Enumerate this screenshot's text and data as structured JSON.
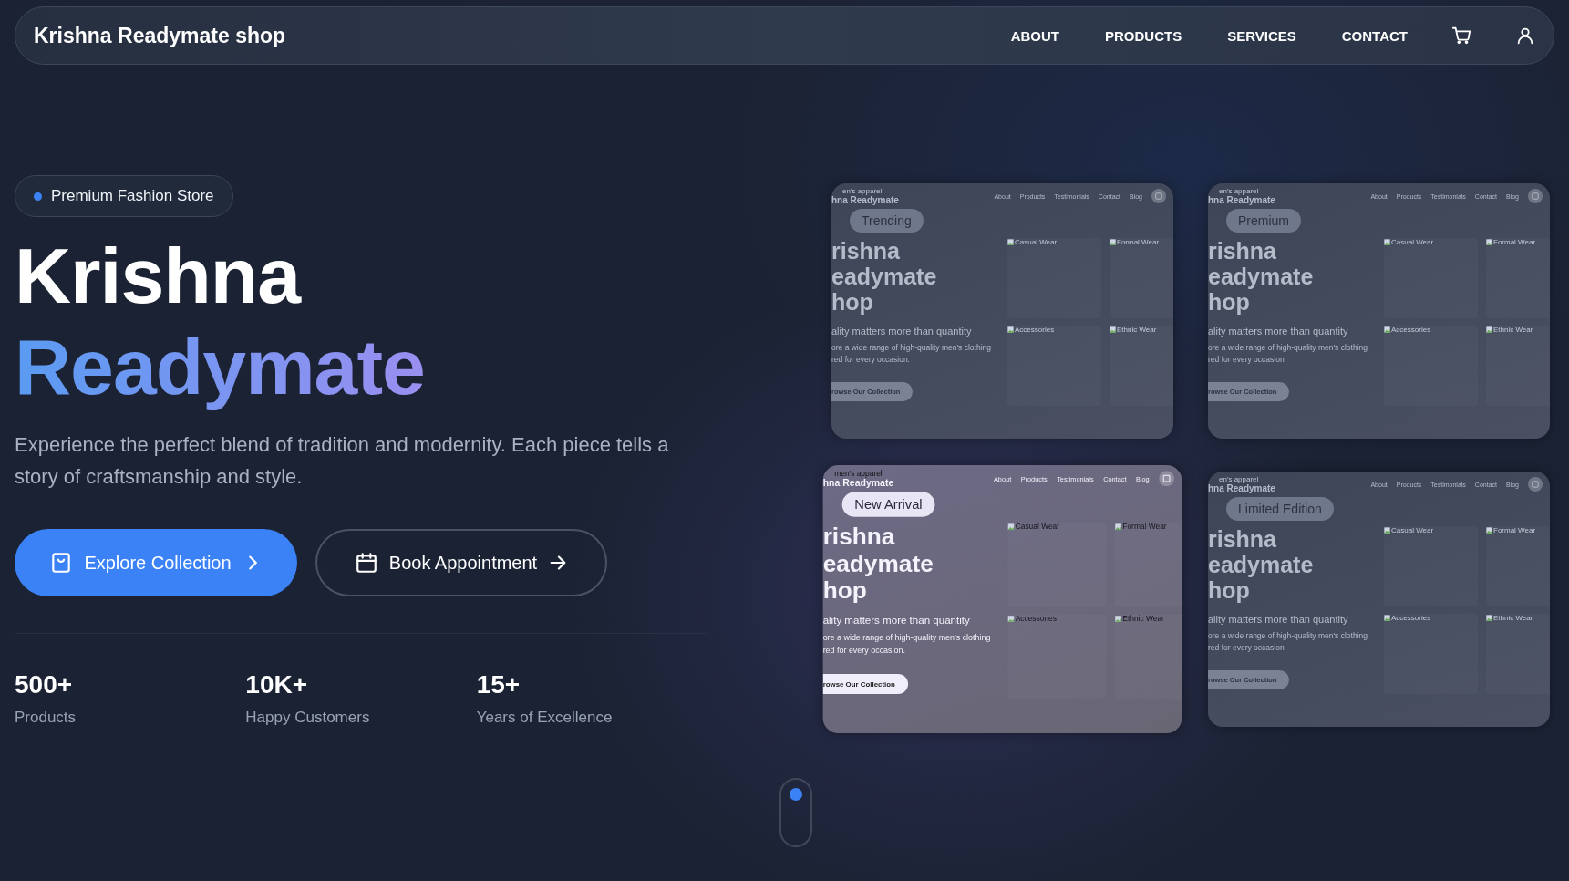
{
  "navbar": {
    "brand": "Krishna Readymate shop",
    "links": [
      "ABOUT",
      "PRODUCTS",
      "SERVICES",
      "CONTACT"
    ]
  },
  "hero": {
    "badge": "Premium Fashion Store",
    "title_line_1": "Krishna",
    "title_line_2": "Readymate",
    "description": "Experience the perfect blend of tradition and modernity. Each piece tells a story of craftsmanship and style.",
    "buttons": [
      {
        "label": "Explore Collection",
        "kind": "primary"
      },
      {
        "label": "Book Appointment",
        "kind": "outline"
      }
    ],
    "stats": [
      {
        "value": "500+",
        "label": "Products"
      },
      {
        "value": "10K+",
        "label": "Happy Customers"
      },
      {
        "value": "15+",
        "label": "Years of Excellence"
      }
    ]
  },
  "showcase": [
    {
      "badge": "Trending",
      "selected": false,
      "preview": {
        "tagline": "en's apparel",
        "brand": "hna Readymate",
        "nav": [
          "About",
          "Products",
          "Testimonials",
          "Contact",
          "Blog"
        ],
        "headline": [
          "rishna",
          "eadymate",
          "hop"
        ],
        "subtitle": "ality matters more than quantity",
        "description": [
          "ore a wide range of high-quality men's clothing",
          "red for every occasion."
        ],
        "button": "rowse Our Collection",
        "tiles": [
          "Casual Wear",
          "Formal Wear",
          "Accessories",
          "Ethnic Wear"
        ]
      }
    },
    {
      "badge": "Premium",
      "selected": false,
      "preview": {
        "tagline": "en's apparel",
        "brand": "hna Readymate",
        "nav": [
          "About",
          "Products",
          "Testimonials",
          "Contact",
          "Blog"
        ],
        "headline": [
          "rishna",
          "eadymate",
          "hop"
        ],
        "subtitle": "ality matters more than quantity",
        "description": [
          "ore a wide range of high-quality men's clothing",
          "red for every occasion."
        ],
        "button": "rowse Our Collection",
        "tiles": [
          "Casual Wear",
          "Formal Wear",
          "Accessories",
          "Ethnic Wear"
        ]
      }
    },
    {
      "badge": "New Arrival",
      "selected": true,
      "preview": {
        "tagline": "men's apparel",
        "brand": "hna Readymate",
        "nav": [
          "About",
          "Products",
          "Testimonials",
          "Contact",
          "Blog"
        ],
        "headline": [
          "rishna",
          "eadymate",
          "hop"
        ],
        "subtitle": "ality matters more than quantity",
        "description": [
          "ore a wide range of high-quality men's clothing",
          "red for every occasion."
        ],
        "button": "rowse Our Collection",
        "tiles": [
          "Casual Wear",
          "Formal Wear",
          "Accessories",
          "Ethnic Wear"
        ]
      }
    },
    {
      "badge": "Limited Edition",
      "selected": false,
      "preview": {
        "tagline": "en's apparel",
        "brand": "hna Readymate",
        "nav": [
          "About",
          "Products",
          "Testimonials",
          "Contact",
          "Blog"
        ],
        "headline": [
          "rishna",
          "eadymate",
          "hop"
        ],
        "subtitle": "ality matters more than quantity",
        "description": [
          "ore a wide range of high-quality men's clothing",
          "red for every occasion."
        ],
        "button": "rowse Our Collection",
        "tiles": [
          "Casual Wear",
          "Formal Wear",
          "Accessories",
          "Ethnic Wear"
        ]
      }
    }
  ]
}
